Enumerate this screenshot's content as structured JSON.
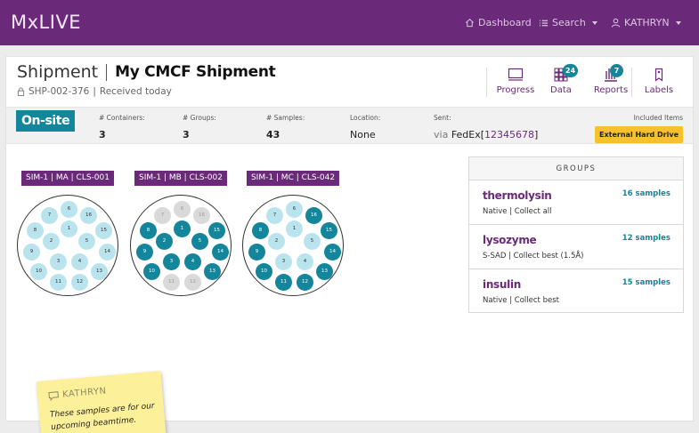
{
  "brand": "MxLIVE",
  "nav": {
    "dashboard": "Dashboard",
    "search": "Search",
    "user": "KATHRYN"
  },
  "header": {
    "section": "Shipment",
    "name": "My CMCF Shipment",
    "id": "SHP-002-376",
    "received": "Received today"
  },
  "tools": {
    "progress": "Progress",
    "data": "Data",
    "data_count": "24",
    "reports": "Reports",
    "reports_count": "7",
    "labels": "Labels"
  },
  "info": {
    "status": "On-site",
    "containers_label": "# Containers:",
    "containers": "3",
    "groups_label": "# Groups:",
    "groups": "3",
    "samples_label": "# Samples:",
    "samples": "43",
    "location_label": "Location:",
    "location": "None",
    "sent_label": "Sent:",
    "sent_via": "via",
    "carrier": "FedEx",
    "tracking": "12345678",
    "included_label": "Included Items",
    "included_item": "External Hard Drive"
  },
  "containers": [
    {
      "name": "SIM-1 | MA | CLS-001",
      "ports": [
        {
          "n": "6",
          "s": "light"
        },
        {
          "n": "7",
          "s": "light"
        },
        {
          "n": "16",
          "s": "light"
        },
        {
          "n": "8",
          "s": "light"
        },
        {
          "n": "1",
          "s": "light"
        },
        {
          "n": "15",
          "s": "light"
        },
        {
          "n": "2",
          "s": "light"
        },
        {
          "n": "5",
          "s": "light"
        },
        {
          "n": "9",
          "s": "light"
        },
        {
          "n": "14",
          "s": "light"
        },
        {
          "n": "3",
          "s": "light"
        },
        {
          "n": "4",
          "s": "light"
        },
        {
          "n": "10",
          "s": "light"
        },
        {
          "n": "13",
          "s": "light"
        },
        {
          "n": "11",
          "s": "light"
        },
        {
          "n": "12",
          "s": "light"
        }
      ]
    },
    {
      "name": "SIM-1 | MB | CLS-002",
      "ports": [
        {
          "n": "6",
          "s": "empty"
        },
        {
          "n": "7",
          "s": "empty"
        },
        {
          "n": "16",
          "s": "empty"
        },
        {
          "n": "8",
          "s": "dark"
        },
        {
          "n": "1",
          "s": "dark"
        },
        {
          "n": "15",
          "s": "dark"
        },
        {
          "n": "2",
          "s": "dark"
        },
        {
          "n": "5",
          "s": "dark"
        },
        {
          "n": "9",
          "s": "dark"
        },
        {
          "n": "14",
          "s": "dark"
        },
        {
          "n": "3",
          "s": "dark"
        },
        {
          "n": "4",
          "s": "dark"
        },
        {
          "n": "10",
          "s": "dark"
        },
        {
          "n": "13",
          "s": "dark"
        },
        {
          "n": "11",
          "s": "empty"
        },
        {
          "n": "12",
          "s": "empty"
        }
      ]
    },
    {
      "name": "SIM-1 | MC | CLS-042",
      "ports": [
        {
          "n": "6",
          "s": "light"
        },
        {
          "n": "7",
          "s": "light"
        },
        {
          "n": "16",
          "s": "dark"
        },
        {
          "n": "8",
          "s": "dark"
        },
        {
          "n": "1",
          "s": "light"
        },
        {
          "n": "15",
          "s": "dark"
        },
        {
          "n": "2",
          "s": "light"
        },
        {
          "n": "5",
          "s": "light"
        },
        {
          "n": "9",
          "s": "dark"
        },
        {
          "n": "14",
          "s": "dark"
        },
        {
          "n": "3",
          "s": "light"
        },
        {
          "n": "4",
          "s": "light"
        },
        {
          "n": "10",
          "s": "dark"
        },
        {
          "n": "13",
          "s": "dark"
        },
        {
          "n": "11",
          "s": "dark"
        },
        {
          "n": "12",
          "s": "dark"
        }
      ]
    }
  ],
  "groups": {
    "title": "GROUPS",
    "items": [
      {
        "name": "thermolysin",
        "count": "16 samples",
        "desc": "Native | Collect all"
      },
      {
        "name": "lysozyme",
        "count": "12 samples",
        "desc": "S-SAD | Collect best (1.5Å)"
      },
      {
        "name": "insulin",
        "count": "15 samples",
        "desc": "Native | Collect best"
      }
    ]
  },
  "note": {
    "author": "KATHRYN",
    "text": "These samples are for our upcoming beamtime."
  },
  "colors": {
    "brand": "#6a2a79",
    "accent": "#14869b",
    "highlight": "#f6c12d"
  }
}
